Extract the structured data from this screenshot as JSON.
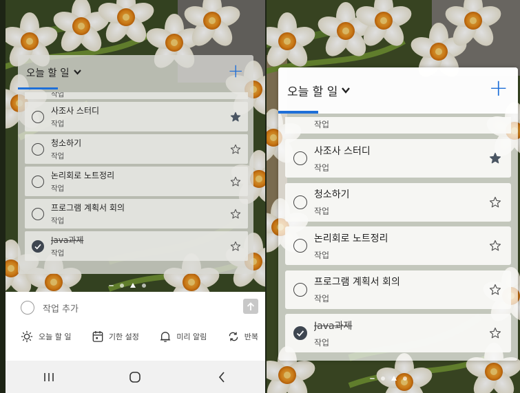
{
  "widget": {
    "title": "오늘 할 일",
    "add_symbol": "+",
    "tasks": [
      {
        "title": "사조사 스터디",
        "list": "작업",
        "completed": false,
        "important": true
      },
      {
        "title": "청소하기",
        "list": "작업",
        "completed": false,
        "important": false
      },
      {
        "title": "논리회로 노트정리",
        "list": "작업",
        "completed": false,
        "important": false
      },
      {
        "title": "프로그램 계획서 회의",
        "list": "작업",
        "completed": false,
        "important": false
      },
      {
        "title": "Java과제",
        "list": "작업",
        "completed": true,
        "important": false
      }
    ],
    "partial_task_sub": "작업"
  },
  "composer": {
    "placeholder": "작업 추가",
    "options": [
      {
        "icon": "sun-icon",
        "label": "오늘 할 일"
      },
      {
        "icon": "calendar-icon",
        "label": "기한 설정"
      },
      {
        "icon": "bell-icon",
        "label": "미리 알림"
      },
      {
        "icon": "repeat-icon",
        "label": "반복"
      }
    ]
  },
  "navbar": {
    "buttons": [
      {
        "icon": "recent-apps-icon",
        "glyph": "|||"
      },
      {
        "icon": "home-icon",
        "glyph": "◯"
      },
      {
        "icon": "back-icon",
        "glyph": "<"
      }
    ]
  },
  "colors": {
    "accent": "#1e6fd8",
    "star_filled": "#4a5562",
    "check_done": "#3e4650"
  }
}
